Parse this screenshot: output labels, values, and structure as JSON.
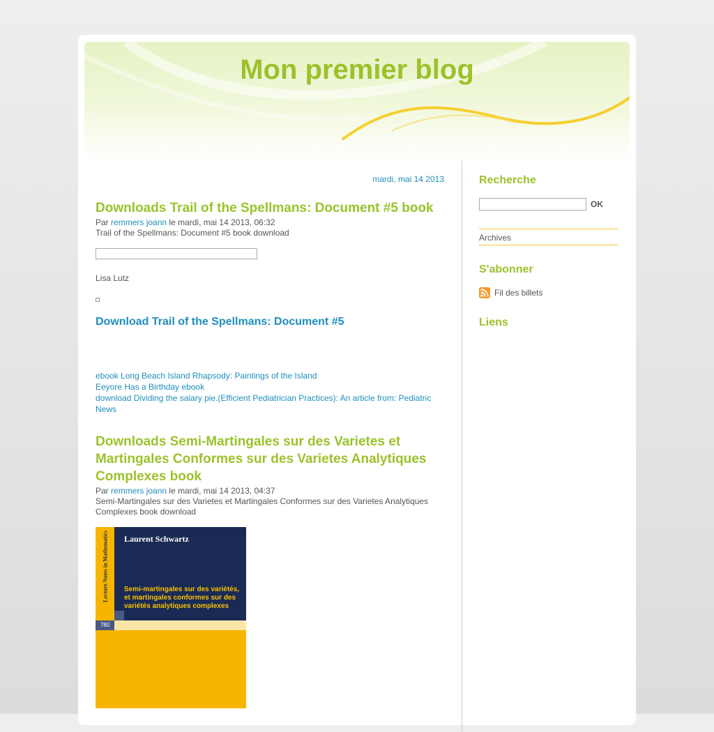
{
  "blog": {
    "title": "Mon premier blog"
  },
  "main": {
    "date_header": "mardi, mai 14 2013",
    "posts": [
      {
        "title": "Downloads Trail of the Spellmans: Document #5 book",
        "meta_prefix": "Par",
        "author": "remmers joann",
        "meta_suffix": "le mardi, mai 14 2013, 06:32",
        "intro": "Trail of the Spellmans: Document #5 book download",
        "book_author": "Lisa Lutz",
        "download_heading": "Download Trail of the Spellmans: Document #5",
        "links": [
          "ebook Long Beach Island Rhapsody: Paintings of the Island",
          "Eeyore Has a Birthday ebook",
          "download Dividing the salary pie.(Efficient Pediatrician Practices): An article from: Pediatric News"
        ]
      },
      {
        "title": "Downloads Semi-Martingales sur des Varietes et Martingales Conformes sur des Varietes Analytiques Complexes book",
        "meta_prefix": "Par",
        "author": "remmers joann",
        "meta_suffix": "le mardi, mai 14 2013, 04:37",
        "intro": "Semi-Martingales sur des Varietes et Martingales Conformes sur des Varietes Analytiques Complexes book download",
        "cover": {
          "series": "Lecture Notes in Mathematics",
          "author": "Laurent Schwartz",
          "title": "Semi-martingales sur des variétés, et martingales conformes sur des variétés analytiques complexes",
          "number": "780",
          "colors": {
            "navy": "#1b2a54",
            "yellow": "#f7b500",
            "pale": "#fbe6a6"
          }
        }
      }
    ]
  },
  "sidebar": {
    "search_title": "Recherche",
    "search_value": "",
    "ok_label": "OK",
    "archives_label": "Archives",
    "subscribe_title": "S'abonner",
    "feed_label": "Fil des billets",
    "links_title": "Liens"
  },
  "colors": {
    "title_green": "#9bc22b",
    "link_blue": "#1f8ebd",
    "accent_yellow": "#f0c830",
    "rss_orange": "#f49a2a"
  },
  "icons": {
    "rss": "rss-feed-icon"
  }
}
